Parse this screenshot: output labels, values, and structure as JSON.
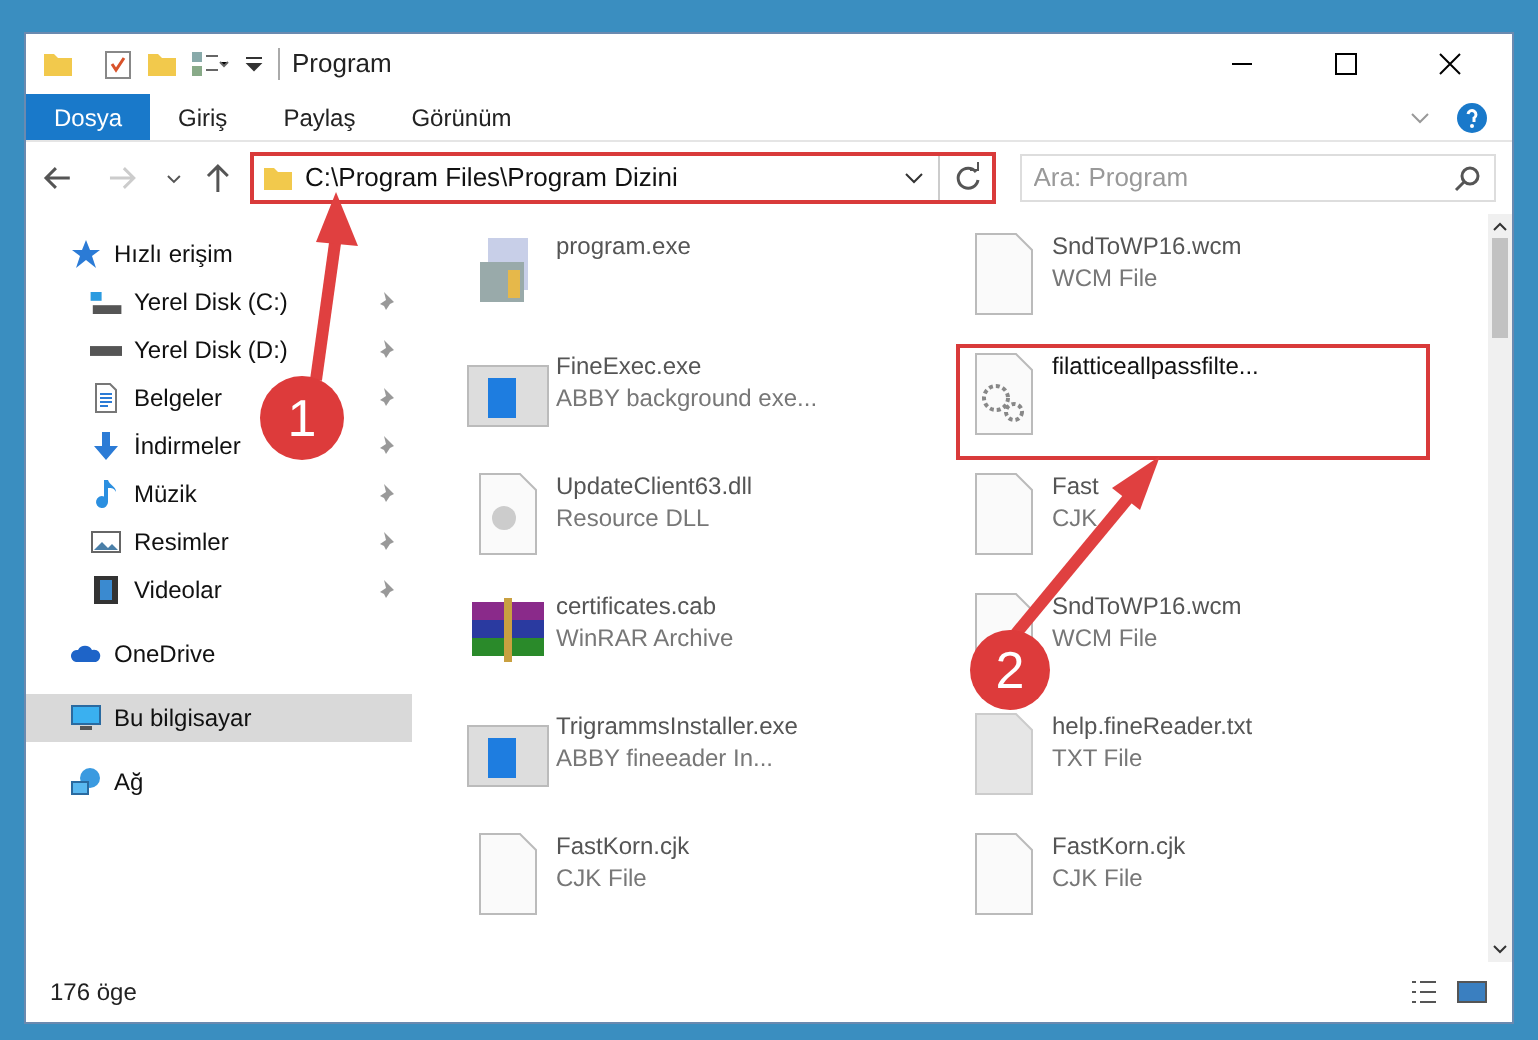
{
  "window": {
    "title": "Program"
  },
  "ribbon_tabs": [
    {
      "label": "Dosya",
      "selected": true
    },
    {
      "label": "Giriş",
      "selected": false
    },
    {
      "label": "Paylaş",
      "selected": false
    },
    {
      "label": "Görünüm",
      "selected": false
    }
  ],
  "address": {
    "path": "C:\\Program Files\\Program Dizini"
  },
  "search": {
    "placeholder": "Ara: Program"
  },
  "sidebar": {
    "items": [
      {
        "label": "Hızlı erişim",
        "kind": "star",
        "selected": false,
        "children": [
          {
            "label": "Yerel Disk (C:)",
            "kind": "drive-c",
            "pinned": true
          },
          {
            "label": "Yerel Disk (D:)",
            "kind": "drive",
            "pinned": true
          },
          {
            "label": "Belgeler",
            "kind": "doc",
            "pinned": true
          },
          {
            "label": "İndirmeler",
            "kind": "download",
            "pinned": true
          },
          {
            "label": "Müzik",
            "kind": "music",
            "pinned": true
          },
          {
            "label": "Resimler",
            "kind": "image",
            "pinned": true
          },
          {
            "label": "Videolar",
            "kind": "video",
            "pinned": true
          }
        ]
      },
      {
        "label": "OneDrive",
        "kind": "cloud",
        "selected": false
      },
      {
        "label": "Bu bilgisayar",
        "kind": "pc",
        "selected": true
      },
      {
        "label": "Ağ",
        "kind": "network",
        "selected": false
      }
    ]
  },
  "files": [
    {
      "name": "program.exe",
      "kind": "setup",
      "blurred": true
    },
    {
      "name": "SndToWP16.wcm",
      "type": "WCM File",
      "kind": "blank",
      "blurred": true
    },
    {
      "name": "FineExec.exe",
      "type": "ABBY background exe...",
      "kind": "app",
      "blurred": true
    },
    {
      "name": "filatticeallpassfilte...",
      "kind": "gear",
      "blurred": false
    },
    {
      "name": "UpdateClient63.dll",
      "type": "Resource DLL",
      "kind": "dll",
      "blurred": true
    },
    {
      "name": "Fast",
      "type": "CJK",
      "kind": "blank",
      "blurred": true
    },
    {
      "name": "certificates.cab",
      "type": "WinRAR Archive",
      "kind": "archive",
      "blurred": true
    },
    {
      "name": "SndToWP16.wcm",
      "type": "WCM File",
      "kind": "blank",
      "blurred": true
    },
    {
      "name": "TrigrammsInstaller.exe",
      "type": "ABBY fineeader In...",
      "kind": "app",
      "blurred": true
    },
    {
      "name": "help.fineReader.txt",
      "type": "TXT File",
      "kind": "text",
      "blurred": true
    },
    {
      "name": "FastKorn.cjk",
      "type": "CJK File",
      "kind": "blank",
      "blurred": true
    },
    {
      "name": "FastKorn.cjk",
      "type": "CJK File",
      "kind": "blank",
      "blurred": true
    }
  ],
  "status_bar": {
    "count": "176 öge"
  },
  "callouts": [
    {
      "label": "1"
    },
    {
      "label": "2"
    }
  ]
}
